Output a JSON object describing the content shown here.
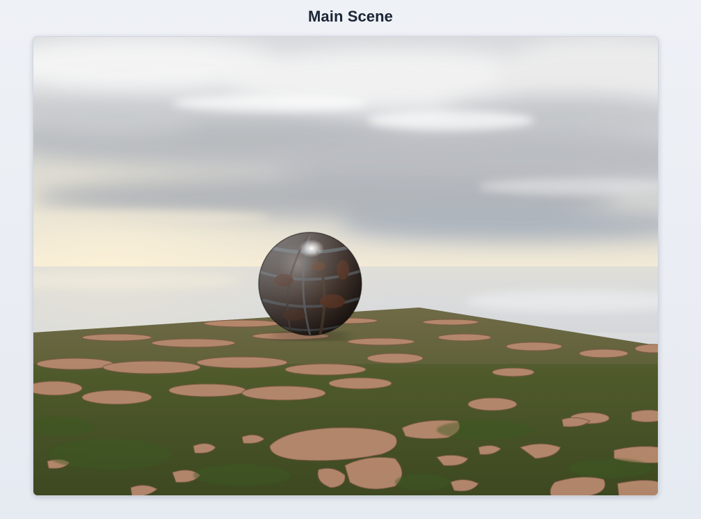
{
  "header": {
    "title": "Main Scene"
  },
  "scene": {
    "sky": {
      "zenith": "#d9dbde",
      "horizon": "#f1ebd9",
      "haze": "#c7cbd2"
    },
    "ground": {
      "grass": "#4e5a2a",
      "grass_dark": "#39431f",
      "stone": "#b5876d",
      "stone_light": "#c99d82"
    },
    "sphere": {
      "material": "rusted-metal",
      "base": "#3a2a22",
      "highlight": "#ffffff"
    }
  }
}
